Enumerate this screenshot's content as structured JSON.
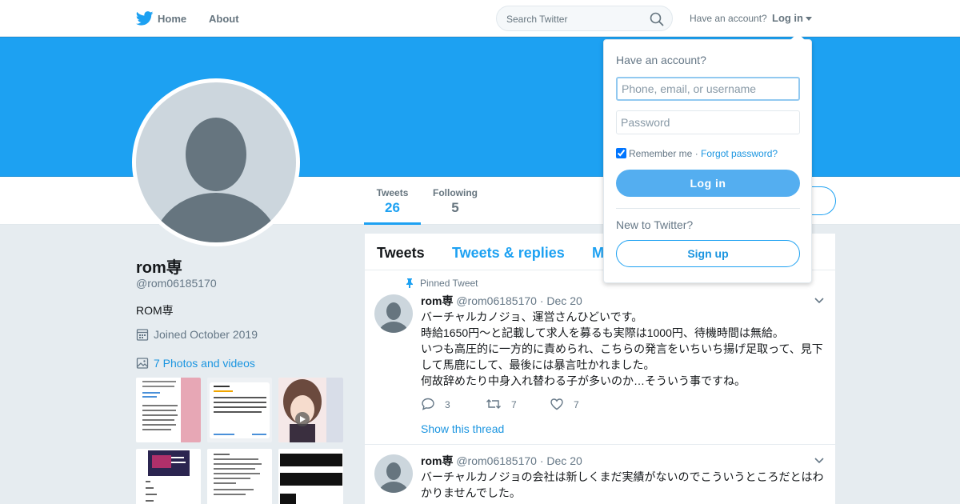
{
  "nav": {
    "logo": "twitter-bird-icon",
    "home_label": "Home",
    "about_label": "About",
    "search_placeholder": "Search Twitter",
    "have_account_text": "Have an account?",
    "login_label": "Log in"
  },
  "profile": {
    "name": "rom専",
    "handle": "@rom06185170",
    "bio": "ROM専",
    "joined": "Joined October 2019",
    "photos_label": "7 Photos and videos",
    "stats": {
      "tweets_label": "Tweets",
      "tweets_value": "26",
      "following_label": "Following",
      "following_value": "5"
    }
  },
  "timeline": {
    "tabs": {
      "tweets": "Tweets",
      "replies": "Tweets & replies",
      "media": "Media"
    },
    "tweets": [
      {
        "pinned_label": "Pinned Tweet",
        "name": "rom専",
        "handle": "@rom06185170",
        "date": "· Dec 20",
        "lines": [
          "バーチャルカノジョ、運営さんひどいです。",
          "時給1650円〜と記載して求人を募るも実際は1000円、待機時間は無給。",
          "いつも高圧的に一方的に責められ、こちらの発言をいちいち揚げ足取って、見下して馬鹿にして、最後には暴言吐かれました。",
          "何故辞めたり中身入れ替わる子が多いのか…そういう事ですね。"
        ],
        "replies": "3",
        "retweets": "7",
        "likes": "7",
        "show_thread": "Show this thread"
      },
      {
        "name": "rom専",
        "handle": "@rom06185170",
        "date": "· Dec 20",
        "lines": [
          "バーチャルカノジョの会社は新しくまだ実績がないのでこういうところだとはわかりませんでした。"
        ]
      }
    ]
  },
  "login_dropdown": {
    "title": "Have an account?",
    "username_placeholder": "Phone, email, or username",
    "password_placeholder": "Password",
    "remember_label": "Remember me",
    "separator": " · ",
    "forgot_label": "Forgot password?",
    "login_button": "Log in",
    "new_label": "New to Twitter?",
    "signup_button": "Sign up"
  },
  "colors": {
    "brand_blue": "#1da1f2",
    "link_blue": "#1b95e0",
    "background": "#e6ecf0"
  }
}
